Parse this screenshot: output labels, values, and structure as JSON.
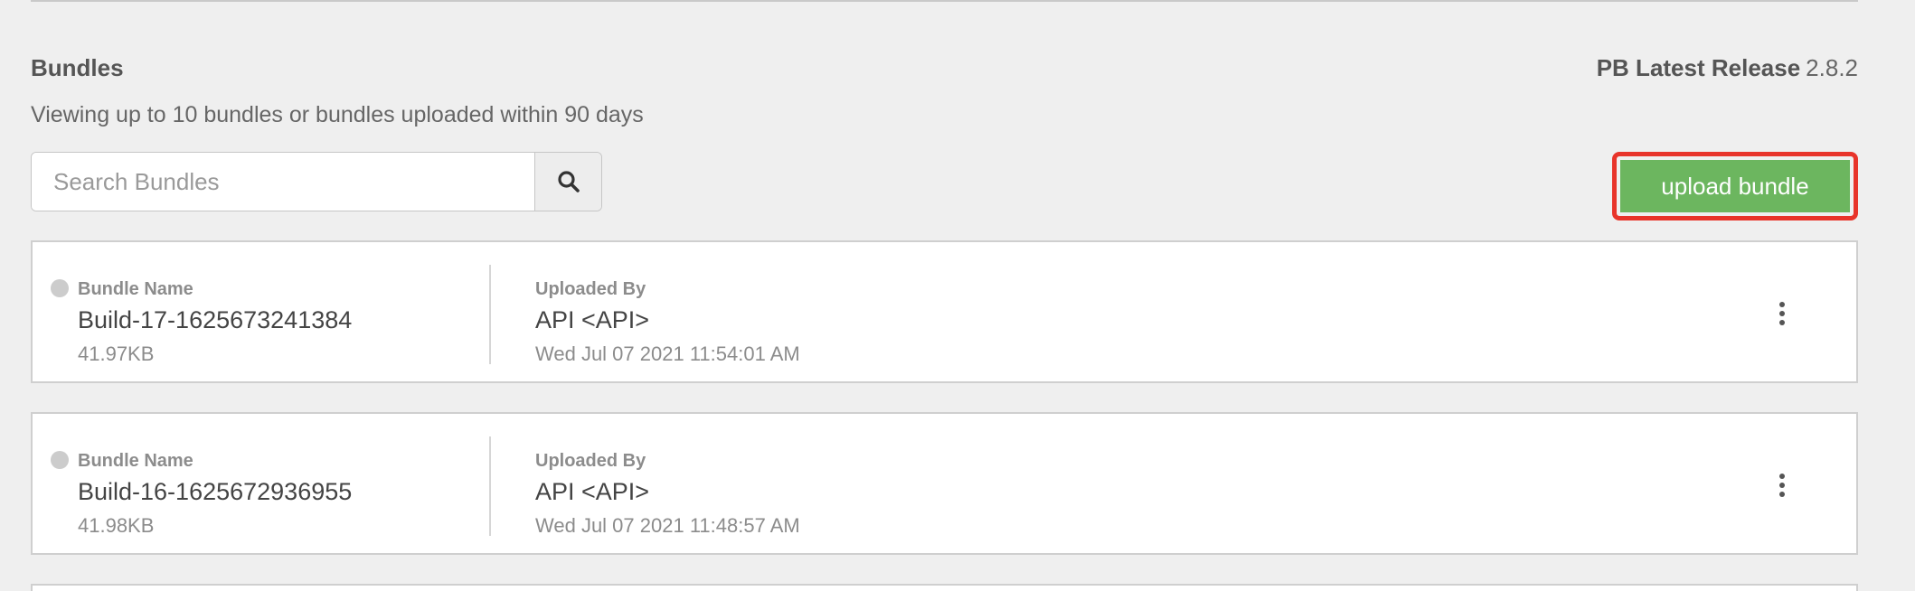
{
  "header": {
    "section_title": "Bundles",
    "release_label": "PB Latest Release",
    "release_version": "2.8.2",
    "subtitle": "Viewing up to 10 bundles or bundles uploaded within 90 days"
  },
  "search": {
    "placeholder": "Search Bundles",
    "value": "",
    "icon": "search-icon"
  },
  "actions": {
    "upload_label": "upload bundle",
    "upload_color": "#6cb65f",
    "highlight_color": "#e8342a"
  },
  "bundles": [
    {
      "name_label": "Bundle Name",
      "name": "Build-17-1625673241384",
      "size": "41.97KB",
      "uploaded_by_label": "Uploaded By",
      "uploaded_by": "API <API>",
      "uploaded_at": "Wed Jul 07 2021 11:54:01 AM",
      "menu_icon": "more-vertical-icon"
    },
    {
      "name_label": "Bundle Name",
      "name": "Build-16-1625672936955",
      "size": "41.98KB",
      "uploaded_by_label": "Uploaded By",
      "uploaded_by": "API <API>",
      "uploaded_at": "Wed Jul 07 2021 11:48:57 AM",
      "menu_icon": "more-vertical-icon"
    }
  ]
}
